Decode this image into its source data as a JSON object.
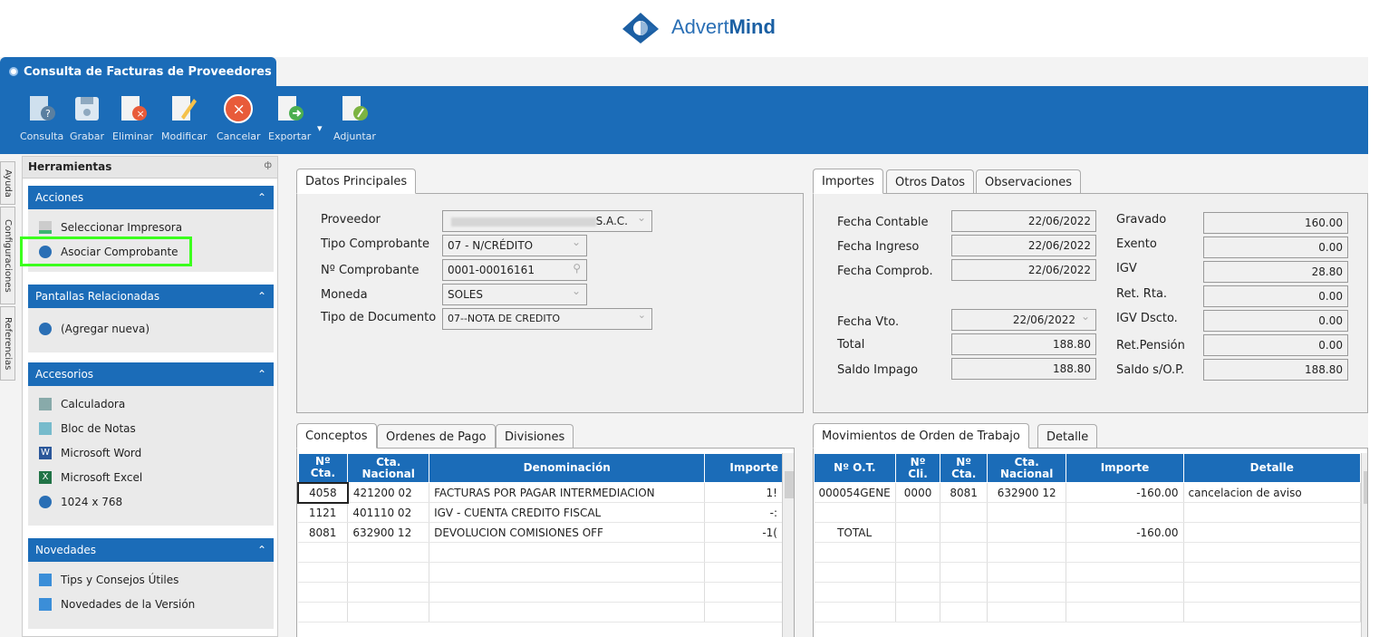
{
  "brand": {
    "name_plain": "Advert",
    "name_bold": "Mind"
  },
  "window": {
    "title": "Consulta de Facturas de Proveedores"
  },
  "toolbar": {
    "consulta": "Consulta",
    "grabar": "Grabar",
    "eliminar": "Eliminar",
    "modificar": "Modificar",
    "cancelar": "Cancelar",
    "exportar": "Exportar",
    "adjuntar": "Adjuntar"
  },
  "side_tabs": [
    "Ayuda",
    "Configuraciones",
    "Referencias"
  ],
  "tools": {
    "title": "Herramientas",
    "pin": "ф",
    "acciones": {
      "title": "Acciones",
      "items": [
        "Seleccionar Impresora",
        "Asociar Comprobante"
      ]
    },
    "relacionadas": {
      "title": "Pantallas Relacionadas",
      "items": [
        "(Agregar nueva)"
      ]
    },
    "accesorios": {
      "title": "Accesorios",
      "items": [
        "Calculadora",
        "Bloc de Notas",
        "Microsoft Word",
        "Microsoft Excel",
        "1024 x 768"
      ]
    },
    "novedades": {
      "title": "Novedades",
      "items": [
        "Tips y Consejos Útiles",
        "Novedades de la Versión"
      ]
    }
  },
  "datos": {
    "tab": "Datos Principales",
    "proveedor_label": "Proveedor",
    "proveedor_value": "S.A.C.",
    "tipo_label": "Tipo Comprobante",
    "tipo_value": "07 - N/CRÉDITO",
    "num_label": "Nº Comprobante",
    "num_value": "0001-00016161",
    "moneda_label": "Moneda",
    "moneda_value": "SOLES",
    "tipodoc_label": "Tipo de Documento",
    "tipodoc_value": "07--NOTA DE CREDITO"
  },
  "importes": {
    "tabs": [
      "Importes",
      "Otros Datos",
      "Observaciones"
    ],
    "left": [
      {
        "label": "Fecha Contable",
        "value": "22/06/2022"
      },
      {
        "label": "Fecha Ingreso",
        "value": "22/06/2022"
      },
      {
        "label": "Fecha Comprob.",
        "value": "22/06/2022"
      },
      {
        "label": "Fecha Vto.",
        "value": "22/06/2022"
      },
      {
        "label": "Total",
        "value": "188.80"
      },
      {
        "label": "Saldo Impago",
        "value": "188.80"
      }
    ],
    "right": [
      {
        "label": "Gravado",
        "value": "160.00"
      },
      {
        "label": "Exento",
        "value": "0.00"
      },
      {
        "label": "IGV",
        "value": "28.80"
      },
      {
        "label": "Ret. Rta.",
        "value": "0.00"
      },
      {
        "label": "IGV Dscto.",
        "value": "0.00"
      },
      {
        "label": "Ret.Pensión",
        "value": "0.00"
      },
      {
        "label": "Saldo s/O.P.",
        "value": "188.80"
      }
    ]
  },
  "conceptos": {
    "tabs": [
      "Conceptos",
      "Ordenes de Pago",
      "Divisiones"
    ],
    "headers": [
      "Nº Cta.",
      "Cta. Nacional",
      "Denominación",
      "Importe"
    ],
    "rows": [
      [
        "4058",
        "421200 02",
        "FACTURAS POR PAGAR INTERMEDIACION",
        "1!"
      ],
      [
        "1121",
        "401110 02",
        "IGV - CUENTA CREDITO FISCAL",
        "-:"
      ],
      [
        "8081",
        "632900 12",
        "DEVOLUCION COMISIONES OFF",
        "-1("
      ]
    ]
  },
  "movimientos": {
    "tabs": [
      "Movimientos de Orden de Trabajo",
      "Detalle"
    ],
    "headers": [
      "Nº O.T.",
      "Nº Cli.",
      "Nº Cta.",
      "Cta. Nacional",
      "Importe",
      "Detalle"
    ],
    "rows": [
      [
        "000054GENE",
        "0000",
        "8081",
        "632900 12",
        "-160.00",
        "cancelacion de aviso"
      ]
    ],
    "total_label": "TOTAL",
    "total_value": "-160.00"
  },
  "colors": {
    "accent": "#1b6cb8",
    "highlight": "#3cff1e"
  }
}
